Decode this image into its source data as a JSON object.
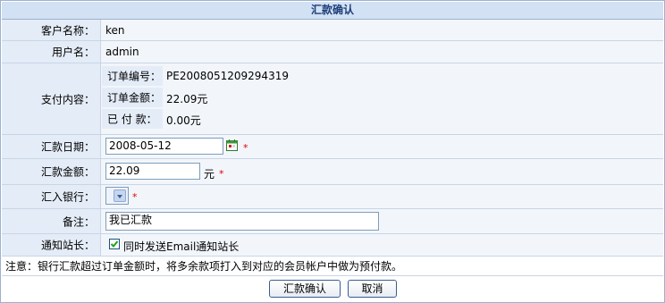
{
  "title": "汇款确认",
  "rows": {
    "customer": {
      "label": "客户名称：",
      "value": "ken"
    },
    "username": {
      "label": "用户名：",
      "value": "admin"
    },
    "payment": {
      "label": "支付内容：",
      "order_no": {
        "label": "订单编号：",
        "value": "PE2008051209294319"
      },
      "order_amount": {
        "label": "订单金额：",
        "value": "22.09元"
      },
      "paid": {
        "label": "已 付 款：",
        "value": "0.00元"
      }
    },
    "date": {
      "label": "汇款日期：",
      "value": "2008-05-12",
      "required": "*",
      "icon": "calendar-icon"
    },
    "amount": {
      "label": "汇款金额：",
      "value": "22.09",
      "unit": "元",
      "required": "*"
    },
    "bank": {
      "label": "汇入银行：",
      "value": "",
      "required": "*"
    },
    "remark": {
      "label": "备注：",
      "value": "我已汇款"
    },
    "notify": {
      "label": "通知站长：",
      "checkbox_label": "同时发送Email通知站长",
      "checked": true
    }
  },
  "note": "注意：银行汇款超过订单金额时，将多余款项打入到对应的会员帐户中做为预付款。",
  "buttons": {
    "confirm": "汇款确认",
    "cancel": "取消"
  },
  "colors": {
    "title_bg": "#d2e1f3",
    "label_bg": "#e4ecf7",
    "row_bg": "#f2f6fb",
    "border": "#9bb1cf",
    "required": "#e00000"
  }
}
